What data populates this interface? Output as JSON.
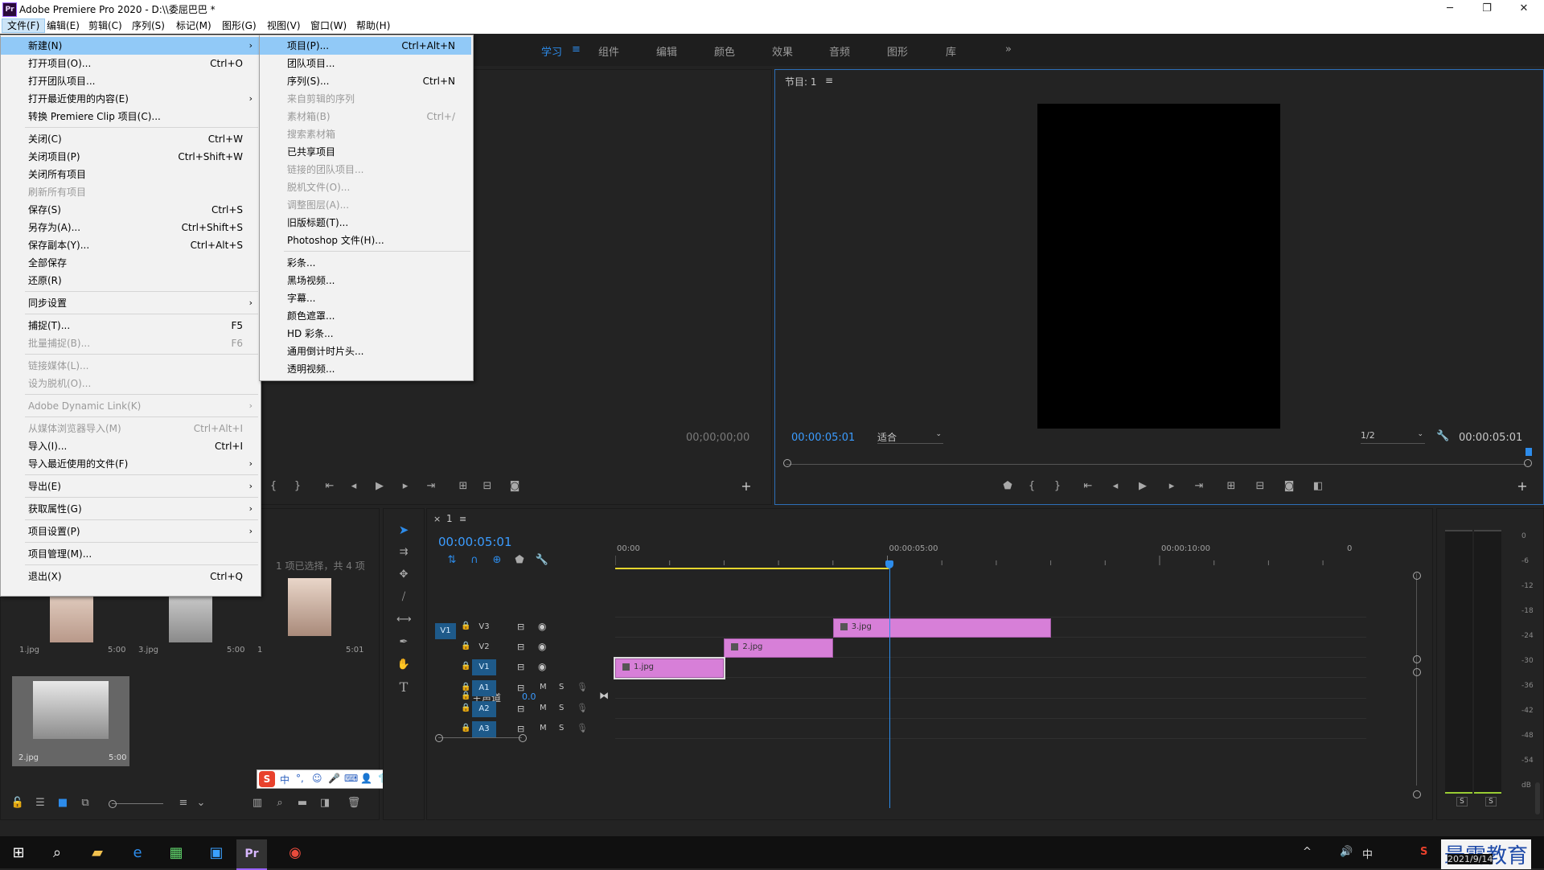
{
  "window": {
    "app_icon": "Pr",
    "title": "Adobe Premiere Pro 2020 - D:\\\\委屈巴巴 *",
    "min": "─",
    "max": "❐",
    "close": "✕"
  },
  "menubar": [
    "文件(F)",
    "编辑(E)",
    "剪辑(C)",
    "序列(S)",
    "标记(M)",
    "图形(G)",
    "视图(V)",
    "窗口(W)",
    "帮助(H)"
  ],
  "workspaces": [
    "学习",
    "组件",
    "编辑",
    "颜色",
    "效果",
    "音频",
    "图形",
    "库"
  ],
  "workspaces_more": "»",
  "file_menu": [
    {
      "label": "新建(N)",
      "sc": "",
      "sub": true,
      "hl": true
    },
    {
      "label": "打开项目(O)...",
      "sc": "Ctrl+O"
    },
    {
      "label": "打开团队项目...",
      "sc": ""
    },
    {
      "label": "打开最近使用的内容(E)",
      "sc": "",
      "sub": true
    },
    {
      "label": "转换 Premiere Clip 项目(C)...",
      "sc": ""
    },
    {
      "sep": true
    },
    {
      "label": "关闭(C)",
      "sc": "Ctrl+W"
    },
    {
      "label": "关闭项目(P)",
      "sc": "Ctrl+Shift+W"
    },
    {
      "label": "关闭所有项目",
      "sc": ""
    },
    {
      "label": "刷新所有项目",
      "sc": "",
      "disabled": true
    },
    {
      "label": "保存(S)",
      "sc": "Ctrl+S"
    },
    {
      "label": "另存为(A)...",
      "sc": "Ctrl+Shift+S"
    },
    {
      "label": "保存副本(Y)...",
      "sc": "Ctrl+Alt+S"
    },
    {
      "label": "全部保存",
      "sc": ""
    },
    {
      "label": "还原(R)",
      "sc": ""
    },
    {
      "sep": true
    },
    {
      "label": "同步设置",
      "sc": "",
      "sub": true
    },
    {
      "sep": true
    },
    {
      "label": "捕捉(T)...",
      "sc": "F5"
    },
    {
      "label": "批量捕捉(B)...",
      "sc": "F6",
      "disabled": true
    },
    {
      "sep": true
    },
    {
      "label": "链接媒体(L)...",
      "sc": "",
      "disabled": true
    },
    {
      "label": "设为脱机(O)...",
      "sc": "",
      "disabled": true
    },
    {
      "sep": true
    },
    {
      "label": "Adobe Dynamic Link(K)",
      "sc": "",
      "sub": true,
      "disabled": true
    },
    {
      "sep": true
    },
    {
      "label": "从媒体浏览器导入(M)",
      "sc": "Ctrl+Alt+I",
      "disabled": true
    },
    {
      "label": "导入(I)...",
      "sc": "Ctrl+I"
    },
    {
      "label": "导入最近使用的文件(F)",
      "sc": "",
      "sub": true
    },
    {
      "sep": true
    },
    {
      "label": "导出(E)",
      "sc": "",
      "sub": true
    },
    {
      "sep": true
    },
    {
      "label": "获取属性(G)",
      "sc": "",
      "sub": true
    },
    {
      "sep": true
    },
    {
      "label": "项目设置(P)",
      "sc": "",
      "sub": true
    },
    {
      "sep": true
    },
    {
      "label": "项目管理(M)...",
      "sc": ""
    },
    {
      "sep": true
    },
    {
      "label": "退出(X)",
      "sc": "Ctrl+Q"
    }
  ],
  "new_menu": [
    {
      "label": "项目(P)...",
      "sc": "Ctrl+Alt+N",
      "hl": true
    },
    {
      "label": "团队项目...",
      "sc": ""
    },
    {
      "label": "序列(S)...",
      "sc": "Ctrl+N"
    },
    {
      "label": "来自剪辑的序列",
      "sc": "",
      "disabled": true
    },
    {
      "label": "素材箱(B)",
      "sc": "Ctrl+/",
      "disabled": true
    },
    {
      "label": "搜索素材箱",
      "sc": "",
      "disabled": true
    },
    {
      "label": "已共享项目",
      "sc": ""
    },
    {
      "label": "链接的团队项目...",
      "sc": "",
      "disabled": true
    },
    {
      "label": "脱机文件(O)...",
      "sc": "",
      "disabled": true
    },
    {
      "label": "调整图层(A)...",
      "sc": "",
      "disabled": true
    },
    {
      "label": "旧版标题(T)...",
      "sc": ""
    },
    {
      "label": "Photoshop 文件(H)...",
      "sc": ""
    },
    {
      "sep": true
    },
    {
      "label": "彩条...",
      "sc": ""
    },
    {
      "label": "黑场视频...",
      "sc": ""
    },
    {
      "label": "字幕...",
      "sc": ""
    },
    {
      "label": "颜色遮罩...",
      "sc": ""
    },
    {
      "label": "HD 彩条...",
      "sc": ""
    },
    {
      "label": "通用倒计时片头...",
      "sc": ""
    },
    {
      "label": "透明视频...",
      "sc": ""
    }
  ],
  "source_monitor": {
    "timecode": "00;00;00;00"
  },
  "program_monitor": {
    "title": "节目: 1",
    "timecode": "00:00:05:01",
    "fit": "适合",
    "resolution": "1/2",
    "duration": "00:00:05:01"
  },
  "project": {
    "status": "1 项已选择，共 4 项",
    "items": [
      {
        "name": "1.jpg",
        "dur": "5:00"
      },
      {
        "name": "3.jpg",
        "dur": "5:00"
      },
      {
        "name": "1",
        "dur": "5:01"
      },
      {
        "name": "2.jpg",
        "dur": "5:00"
      }
    ]
  },
  "timeline": {
    "tab": "1",
    "timecode": "00:00:05:01",
    "ruler": [
      "00:00",
      "00:00:05:00",
      "00:00:10:00",
      "0"
    ],
    "video_tracks": [
      "V3",
      "V2",
      "V1"
    ],
    "audio_tracks": [
      "A1",
      "A2",
      "A3"
    ],
    "source_patch": "V1",
    "master_label": "主声道",
    "master_value": "0.0",
    "mute": "M",
    "solo": "S",
    "clips": [
      {
        "name": "3.jpg",
        "track": "V3",
        "start": 4.0,
        "end": 8.0
      },
      {
        "name": "2.jpg",
        "track": "V2",
        "start": 2.0,
        "end": 4.0
      },
      {
        "name": "1.jpg",
        "track": "V1",
        "start": 0.0,
        "end": 2.0
      }
    ],
    "playhead_sec": 5.03
  },
  "audio_meter": {
    "scale": [
      "0",
      "-6",
      "-12",
      "-18",
      "-24",
      "-30",
      "-36",
      "-42",
      "-48",
      "-54",
      "dB"
    ],
    "solo": [
      "S",
      "S"
    ]
  },
  "ime_bar": [
    "中",
    "°,",
    "☺",
    "🎤",
    "⌨",
    "👤",
    "👕",
    "⊞"
  ],
  "taskbar": {
    "date": "2021/9/14",
    "watermark": "最需教育",
    "tray": [
      "^",
      "🔊",
      "中",
      "S"
    ]
  },
  "colors": {
    "accent_blue": "#2d8ceb",
    "clip_pink": "#d77fd8",
    "menu_highlight": "#91c9f7"
  }
}
